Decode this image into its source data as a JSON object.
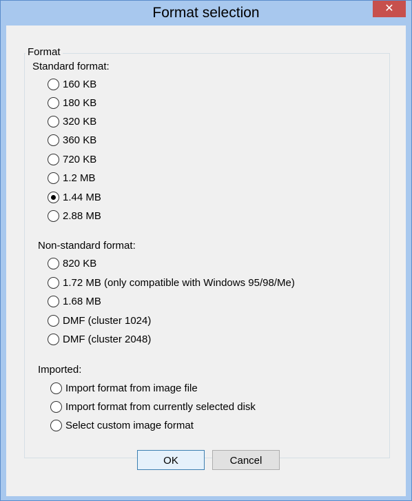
{
  "window": {
    "title": "Format selection",
    "close_glyph": "✕"
  },
  "group": {
    "legend": "Format"
  },
  "standard": {
    "label": "Standard format:",
    "options": [
      "160 KB",
      "180 KB",
      "320 KB",
      "360 KB",
      "720 KB",
      "1.2 MB",
      "1.44 MB",
      "2.88 MB"
    ],
    "selected": "1.44 MB"
  },
  "nonstandard": {
    "label": "Non-standard format:",
    "options": [
      "820 KB",
      "1.72 MB (only compatible with Windows 95/98/Me)",
      "1.68 MB",
      "DMF (cluster 1024)",
      "DMF (cluster 2048)"
    ]
  },
  "imported": {
    "label": "Imported:",
    "options": [
      "Import format from image file",
      "Import format from currently selected disk",
      "Select custom image format"
    ]
  },
  "buttons": {
    "ok": "OK",
    "cancel": "Cancel"
  },
  "colors": {
    "titlebar": "#a8c8ee",
    "close": "#c7504d",
    "client": "#f0f0f0"
  }
}
